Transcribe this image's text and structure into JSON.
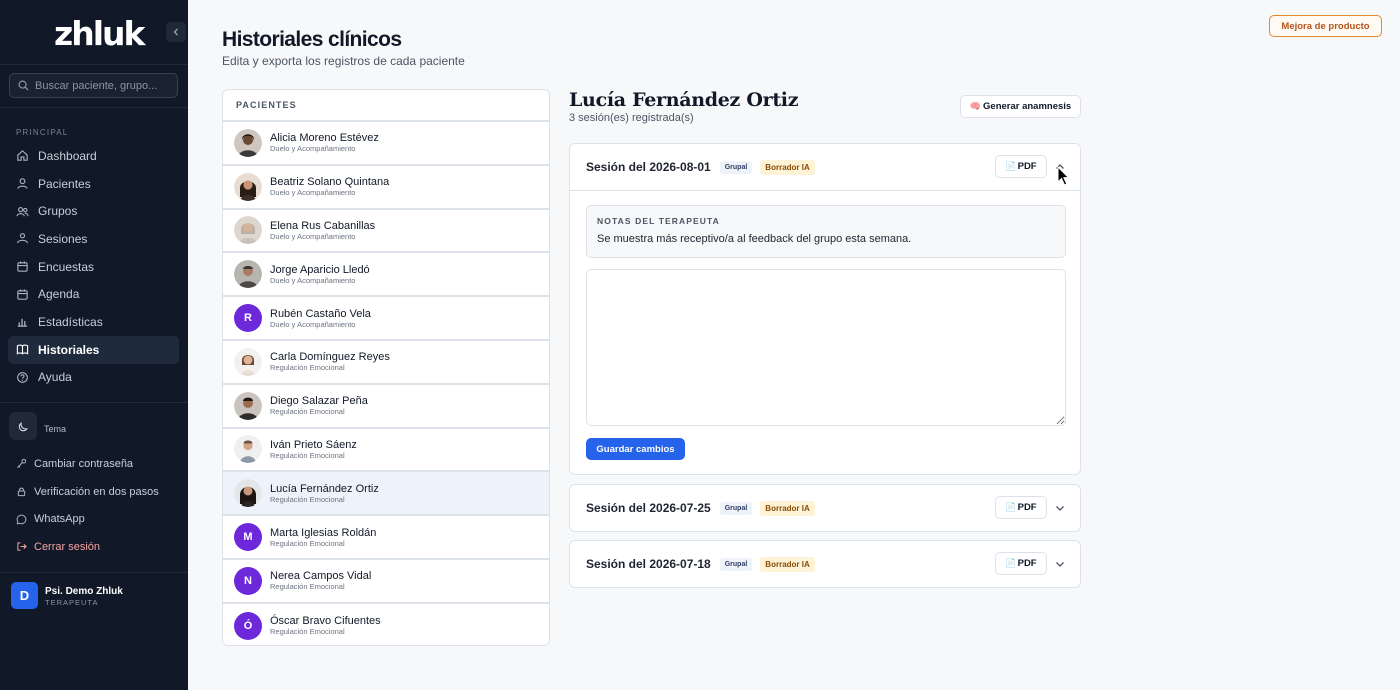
{
  "sidebar": {
    "logo": "zhluk",
    "search_placeholder": "Buscar paciente, grupo...",
    "section_label": "PRINCIPAL",
    "nav": [
      {
        "label": "Dashboard",
        "icon": "home-icon"
      },
      {
        "label": "Pacientes",
        "icon": "user-icon"
      },
      {
        "label": "Grupos",
        "icon": "users-icon"
      },
      {
        "label": "Sesiones",
        "icon": "people-icon"
      },
      {
        "label": "Encuestas",
        "icon": "calendar-icon"
      },
      {
        "label": "Agenda",
        "icon": "calendar-icon"
      },
      {
        "label": "Estadísticas",
        "icon": "bar-chart-icon"
      },
      {
        "label": "Historiales",
        "icon": "book-icon",
        "active": true
      },
      {
        "label": "Ayuda",
        "icon": "help-icon"
      }
    ],
    "theme_label": "Tema",
    "links": [
      {
        "label": "Cambiar contraseña",
        "icon": "key-icon"
      },
      {
        "label": "Verificación en dos pasos",
        "icon": "lock-icon"
      },
      {
        "label": "WhatsApp",
        "icon": "whatsapp-icon"
      },
      {
        "label": "Cerrar sesión",
        "icon": "logout-icon"
      }
    ],
    "user": {
      "initial": "D",
      "name": "Psi. Demo Zhluk",
      "role": "TERAPEUTA"
    }
  },
  "header": {
    "feedback_button": "Mejora de producto",
    "title": "Historiales clínicos",
    "subtitle": "Edita y exporta los registros de cada paciente"
  },
  "patients": {
    "header": "PACIENTES",
    "items": [
      {
        "name": "Alicia Moreno Estévez",
        "group": "Duelo y Acompañamiento",
        "avatar": "photo"
      },
      {
        "name": "Beatriz Solano Quintana",
        "group": "Duelo y Acompañamiento",
        "avatar": "photo"
      },
      {
        "name": "Elena Rus Cabanillas",
        "group": "Duelo y Acompañamiento",
        "avatar": "photo"
      },
      {
        "name": "Jorge Aparicio Lledó",
        "group": "Duelo y Acompañamiento",
        "avatar": "photo"
      },
      {
        "name": "Rubén Castaño Vela",
        "group": "Duelo y Acompañamiento",
        "avatar": "letter",
        "initial": "R"
      },
      {
        "name": "Carla Domínguez Reyes",
        "group": "Regulación Emocional",
        "avatar": "photo"
      },
      {
        "name": "Diego Salazar Peña",
        "group": "Regulación Emocional",
        "avatar": "photo"
      },
      {
        "name": "Iván Prieto Sáenz",
        "group": "Regulación Emocional",
        "avatar": "photo"
      },
      {
        "name": "Lucía Fernández Ortiz",
        "group": "Regulación Emocional",
        "avatar": "photo",
        "selected": true
      },
      {
        "name": "Marta Iglesias Roldán",
        "group": "Regulación Emocional",
        "avatar": "letter",
        "initial": "M"
      },
      {
        "name": "Nerea Campos Vidal",
        "group": "Regulación Emocional",
        "avatar": "letter",
        "initial": "N"
      },
      {
        "name": "Óscar Bravo Cifuentes",
        "group": "Regulación Emocional",
        "avatar": "letter",
        "initial": "Ó"
      }
    ]
  },
  "detail": {
    "patient_name": "Lucía Fernández Ortiz",
    "session_count": "3 sesión(es) registrada(s)",
    "anamnesis_button": "Generar anamnesis",
    "sessions": [
      {
        "title": "Sesión del 2026-08-01",
        "badge_group": "Grupal",
        "badge_ai": "Borrador IA",
        "pdf_label": "PDF",
        "expanded": true,
        "notes_label": "NOTAS DEL TERAPEUTA",
        "notes_text": "Se muestra más receptivo/a al feedback del grupo esta semana.",
        "editor_value": "",
        "save_button": "Guardar cambios"
      },
      {
        "title": "Sesión del 2026-07-25",
        "badge_group": "Grupal",
        "badge_ai": "Borrador IA",
        "pdf_label": "PDF",
        "expanded": false
      },
      {
        "title": "Sesión del 2026-07-18",
        "badge_group": "Grupal",
        "badge_ai": "Borrador IA",
        "pdf_label": "PDF",
        "expanded": false
      }
    ]
  },
  "colors": {
    "sidebar_bg": "#111827",
    "accent_blue": "#2563eb",
    "feedback_orange": "#e28a2a",
    "letter_avatar": "#6d28d9"
  }
}
